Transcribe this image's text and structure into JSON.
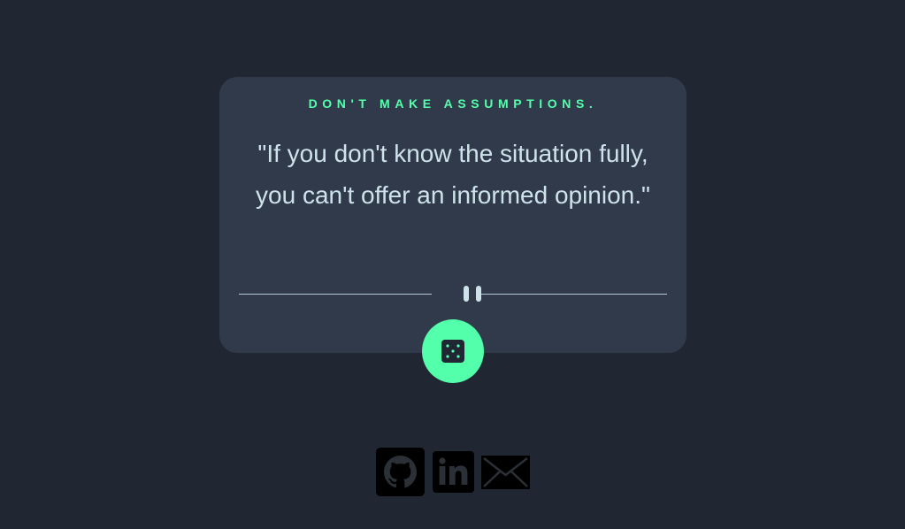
{
  "card": {
    "advice_label": "DON'T MAKE ASSUMPTIONS.",
    "quote": "\"If you don't know the situation fully, you can't offer an informed opinion.\""
  },
  "divider": {
    "icon": "pause-icon"
  },
  "dice_button": {
    "icon": "dice-icon"
  },
  "socials": [
    {
      "icon": "github-icon"
    },
    {
      "icon": "linkedin-icon"
    },
    {
      "icon": "mail-icon"
    }
  ],
  "colors": {
    "background": "#202632",
    "card": "#313a4b",
    "accent": "#53ffab",
    "text": "#cee3e9",
    "icons": "#000000"
  }
}
